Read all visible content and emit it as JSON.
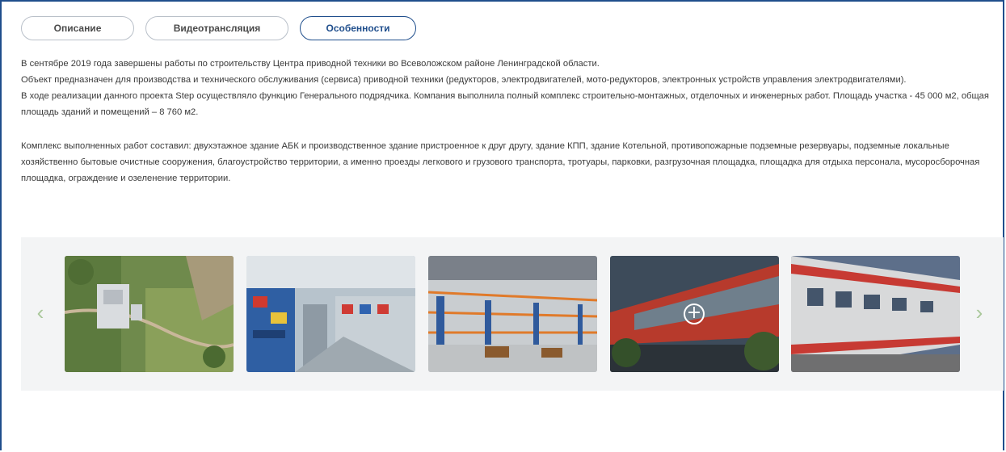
{
  "tabs": [
    {
      "label": "Описание",
      "active": false
    },
    {
      "label": "Видеотрансляция",
      "active": false
    },
    {
      "label": "Особенности",
      "active": true
    }
  ],
  "description": {
    "p1": "В сентябре 2019 года завершены работы по строительству Центра приводной техники во Всеволожском районе Ленинградской области.",
    "p2": "Объект предназначен для производства и технического обслуживания (сервиса) приводной техники (редукторов, электродвигателей, мото-редукторов, электронных устройств управления электродвигателями).",
    "p3": "В ходе реализации данного проекта Step осуществляло функцию Генерального подрядчика. Компания выполнила полный комплекс строительно-монтажных, отделочных и инженерных работ. Площадь участка - 45 000 м2, общая площадь зданий и помещений – 8 760 м2.",
    "p4": "Комплекс выполненных работ составил: двухэтажное здание АБК и производственное здание пристроенное к друг другу, здание КПП, здание Котельной, противопожарные подземные резервуары, подземные локальные хозяйственно бытовые очистные сооружения, благоустройство территории, а именно проезды легкового и грузового транспорта, тротуары, парковки, разгрузочная площадка, площадка для отдыха персонала, мусоросборочная площадка, ограждение и озеленение территории."
  },
  "gallery": {
    "prev_icon": "chevron-left-icon",
    "next_icon": "chevron-right-icon",
    "prev_glyph": "‹",
    "next_glyph": "›",
    "zoom_glyph": "+",
    "images": [
      "aerial-site-photo",
      "factory-interior-photo",
      "warehouse-shelves-photo",
      "building-exterior-dusk-photo",
      "building-facade-photo"
    ]
  },
  "colors": {
    "accent": "#1f4e8c",
    "arrow": "#a9c79a",
    "gallery_bg": "#f3f4f5"
  }
}
